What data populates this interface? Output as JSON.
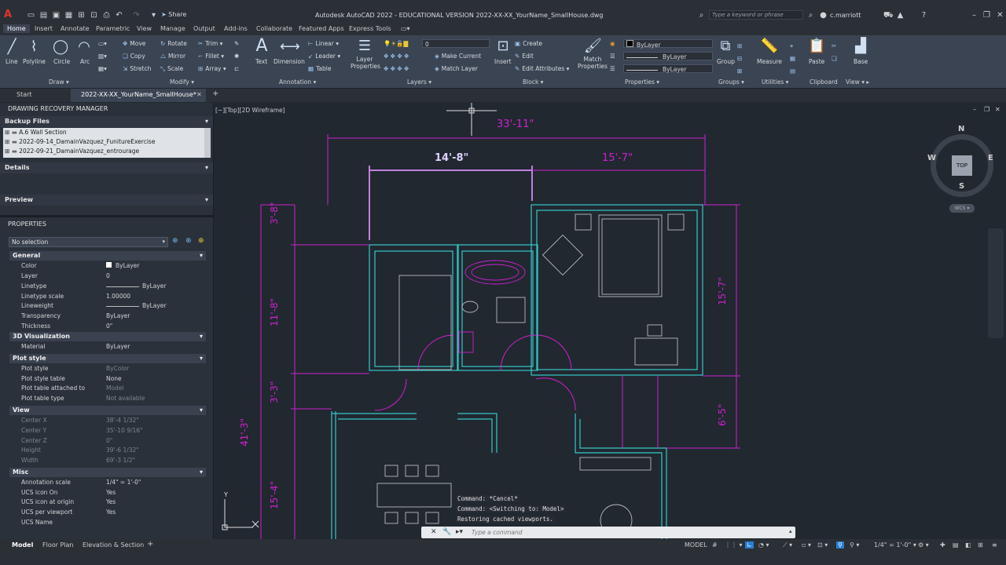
{
  "title": "Autodesk AutoCAD 2022 - EDUCATIONAL VERSION   2022-XX-XX_YourName_SmallHouse.dwg",
  "share_label": "Share",
  "search_placeholder": "Type a keyword or phrase",
  "username": "c.marriott",
  "app_letter": "A",
  "ribbon_tabs": [
    "Home",
    "Insert",
    "Annotate",
    "Parametric",
    "View",
    "Manage",
    "Output",
    "Add-ins",
    "Collaborate",
    "Featured Apps",
    "Express Tools"
  ],
  "draw": {
    "line": "Line",
    "polyline": "Polyline",
    "circle": "Circle",
    "arc": "Arc",
    "panel": "Draw"
  },
  "modify": {
    "move": "Move",
    "rotate": "Rotate",
    "trim": "Trim",
    "copy": "Copy",
    "mirror": "Mirror",
    "fillet": "Fillet",
    "stretch": "Stretch",
    "scale": "Scale",
    "array": "Array",
    "panel": "Modify"
  },
  "annotation": {
    "text": "Text",
    "dimension": "Dimension",
    "linear": "Linear",
    "leader": "Leader",
    "table": "Table",
    "panel": "Annotation"
  },
  "layers": {
    "properties": "Layer Properties",
    "current_layer": "0",
    "make_current": "Make Current",
    "match_layer": "Match Layer",
    "panel": "Layers"
  },
  "block": {
    "insert": "Insert",
    "create": "Create",
    "edit": "Edit",
    "edit_attributes": "Edit Attributes",
    "panel": "Block"
  },
  "properties_panel": {
    "match": "Match Properties",
    "bylayer1": "ByLayer",
    "bylayer2": "ByLayer",
    "bylayer3": "ByLayer",
    "panel": "Properties"
  },
  "groups": {
    "group": "Group",
    "panel": "Groups"
  },
  "utilities": {
    "measure": "Measure",
    "panel": "Utilities"
  },
  "clipboard": {
    "paste": "Paste",
    "panel": "Clipboard"
  },
  "view_panel": {
    "base": "Base",
    "panel": "View"
  },
  "doc_tabs": {
    "start": "Start",
    "active": "2022-XX-XX_YourName_SmallHouse*"
  },
  "viewport_label": "[−][Top][2D Wireframe]",
  "recovery": {
    "title": "DRAWING RECOVERY MANAGER",
    "backup_files": "Backup Files",
    "files": [
      "A.6 Wall Section",
      "2022-09-14_DamainVazquez_FunitureExercise",
      "2022-09-21_DamainVazquez_entrourage"
    ],
    "details": "Details",
    "preview": "Preview"
  },
  "properties": {
    "title": "PROPERTIES",
    "selection": "No selection",
    "groups": {
      "general": "General",
      "visualization": "3D Visualization",
      "plot": "Plot style",
      "view": "View",
      "misc": "Misc"
    },
    "general": [
      {
        "k": "Color",
        "v": "ByLayer"
      },
      {
        "k": "Layer",
        "v": "0"
      },
      {
        "k": "Linetype",
        "v": "ByLayer"
      },
      {
        "k": "Linetype scale",
        "v": "1.00000"
      },
      {
        "k": "Lineweight",
        "v": "ByLayer"
      },
      {
        "k": "Transparency",
        "v": "ByLayer"
      },
      {
        "k": "Thickness",
        "v": "0\""
      }
    ],
    "visualization": [
      {
        "k": "Material",
        "v": "ByLayer"
      }
    ],
    "plot": [
      {
        "k": "Plot style",
        "v": "ByColor"
      },
      {
        "k": "Plot style table",
        "v": "None"
      },
      {
        "k": "Plot table attached to",
        "v": "Model"
      },
      {
        "k": "Plot table type",
        "v": "Not available"
      }
    ],
    "view": [
      {
        "k": "Center X",
        "v": "38'-4 1/32\""
      },
      {
        "k": "Center Y",
        "v": "35'-10 9/16\""
      },
      {
        "k": "Center Z",
        "v": "0\""
      },
      {
        "k": "Height",
        "v": "39'-6 1/32\""
      },
      {
        "k": "Width",
        "v": "69'-3 1/2\""
      }
    ],
    "misc": [
      {
        "k": "Annotation scale",
        "v": "1/4\" = 1'-0\""
      },
      {
        "k": "UCS icon On",
        "v": "Yes"
      },
      {
        "k": "UCS icon at origin",
        "v": "Yes"
      },
      {
        "k": "UCS per viewport",
        "v": "Yes"
      },
      {
        "k": "UCS Name",
        "v": ""
      }
    ]
  },
  "dims": {
    "overall_top": "33'-11\"",
    "left_room": "14'-8\"",
    "right_room": "15'-7\"",
    "left_v1": "3'-8\"",
    "left_v2": "11'-8\"",
    "left_v3": "3'-3\"",
    "left_overall": "41'-3\"",
    "left_v4": "15'-4\"",
    "right_v1": "15'-7\"",
    "right_v2": "6'-5\""
  },
  "viewcube": {
    "n": "N",
    "s": "S",
    "e": "E",
    "w": "W",
    "top": "TOP",
    "wcs": "WCS"
  },
  "ucs": {
    "x": "X",
    "y": "Y"
  },
  "command_history": [
    "Command: *Cancel*",
    "Command:   <Switching to: Model>",
    "Restoring cached viewports."
  ],
  "command_placeholder": "Type a command",
  "layout_tabs": [
    "Model",
    "Floor Plan",
    "Elevation & Section"
  ],
  "status": {
    "model": "MODEL",
    "scale": "1/4\" = 1'-0\""
  },
  "colors": {
    "wall": "#36c8c8",
    "dim": "#d020d0",
    "furniture": "#b8bcc2",
    "accent": "#2a7fd4"
  }
}
